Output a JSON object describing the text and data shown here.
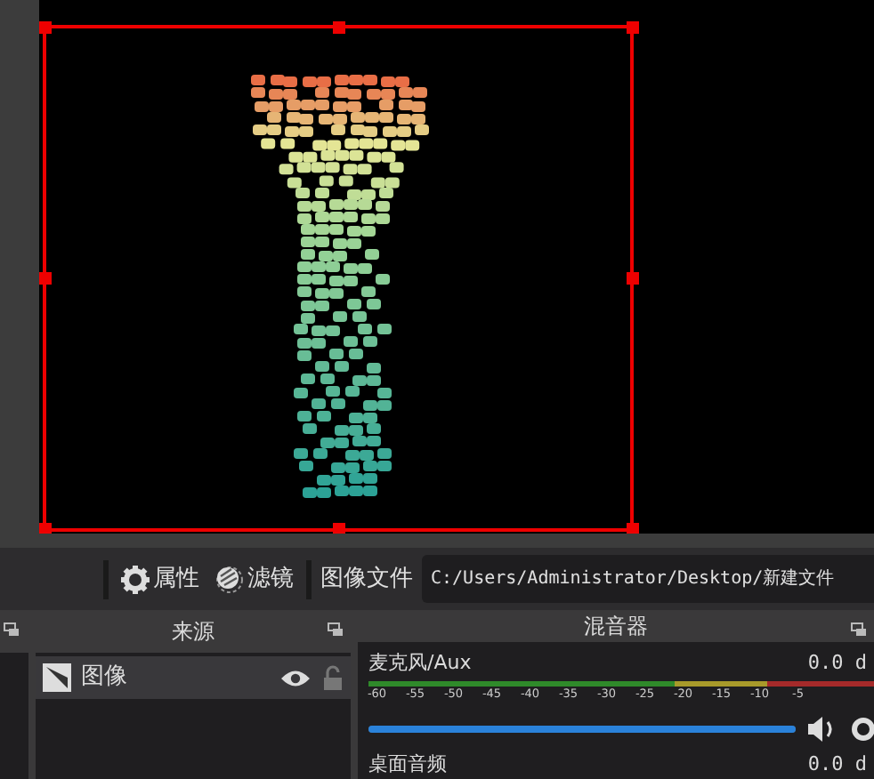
{
  "preview": {
    "selected": true
  },
  "toolbar": {
    "buttons": [
      {
        "label": "属性",
        "kind": "gear"
      },
      {
        "label": "滤镜",
        "kind": "filter"
      }
    ],
    "source_label": "图像文件",
    "path": "C:/Users/Administrator/Desktop/新建文件"
  },
  "sources": {
    "title": "来源",
    "items": [
      {
        "name": "图像",
        "visible": true,
        "locked": false
      }
    ]
  },
  "mixer": {
    "title": "混音器",
    "channels": [
      {
        "name": "麦克风/Aux",
        "reading": "0.0 d",
        "ticks": [
          "-60",
          "-55",
          "-50",
          "-45",
          "-40",
          "-35",
          "-30",
          "-25",
          "-20",
          "-15",
          "-10",
          "-5"
        ],
        "level": 1
      },
      {
        "name": "桌面音频",
        "reading": "0.0 d"
      }
    ]
  }
}
